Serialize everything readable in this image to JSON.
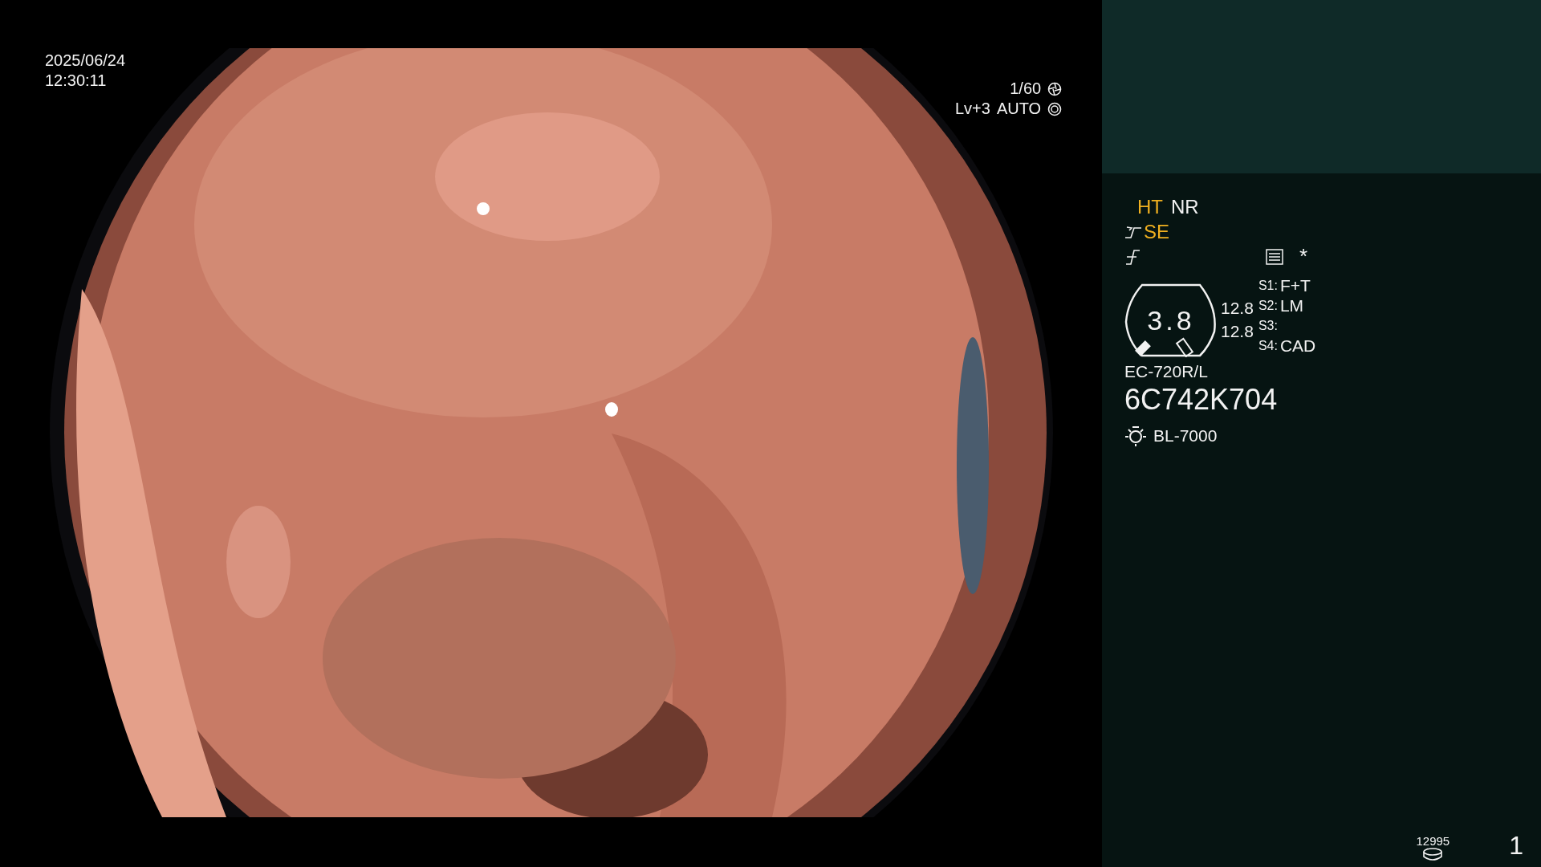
{
  "overlay": {
    "date": "2025/06/24",
    "time": "12:30:11",
    "shutter": "1/60",
    "level": "Lv+3",
    "iris": "AUTO"
  },
  "panel": {
    "indicators": [
      {
        "label": "HT",
        "on": true
      },
      {
        "label": "NR",
        "on": false
      }
    ],
    "se": {
      "label": "SE",
      "on": true
    },
    "gauge_value": "3.8",
    "readings": [
      "12.8",
      "12.8"
    ],
    "switches": [
      {
        "key": "S1:",
        "value": "F+T"
      },
      {
        "key": "S2:",
        "value": "LM"
      },
      {
        "key": "S3:"
      },
      {
        "key": "S4:",
        "value": "CAD"
      }
    ],
    "asterisk": "*",
    "scope_model": "EC-720R/L",
    "serial": "6C742K704",
    "light_source": "BL-7000",
    "storage_count": "12995",
    "page": "1"
  }
}
